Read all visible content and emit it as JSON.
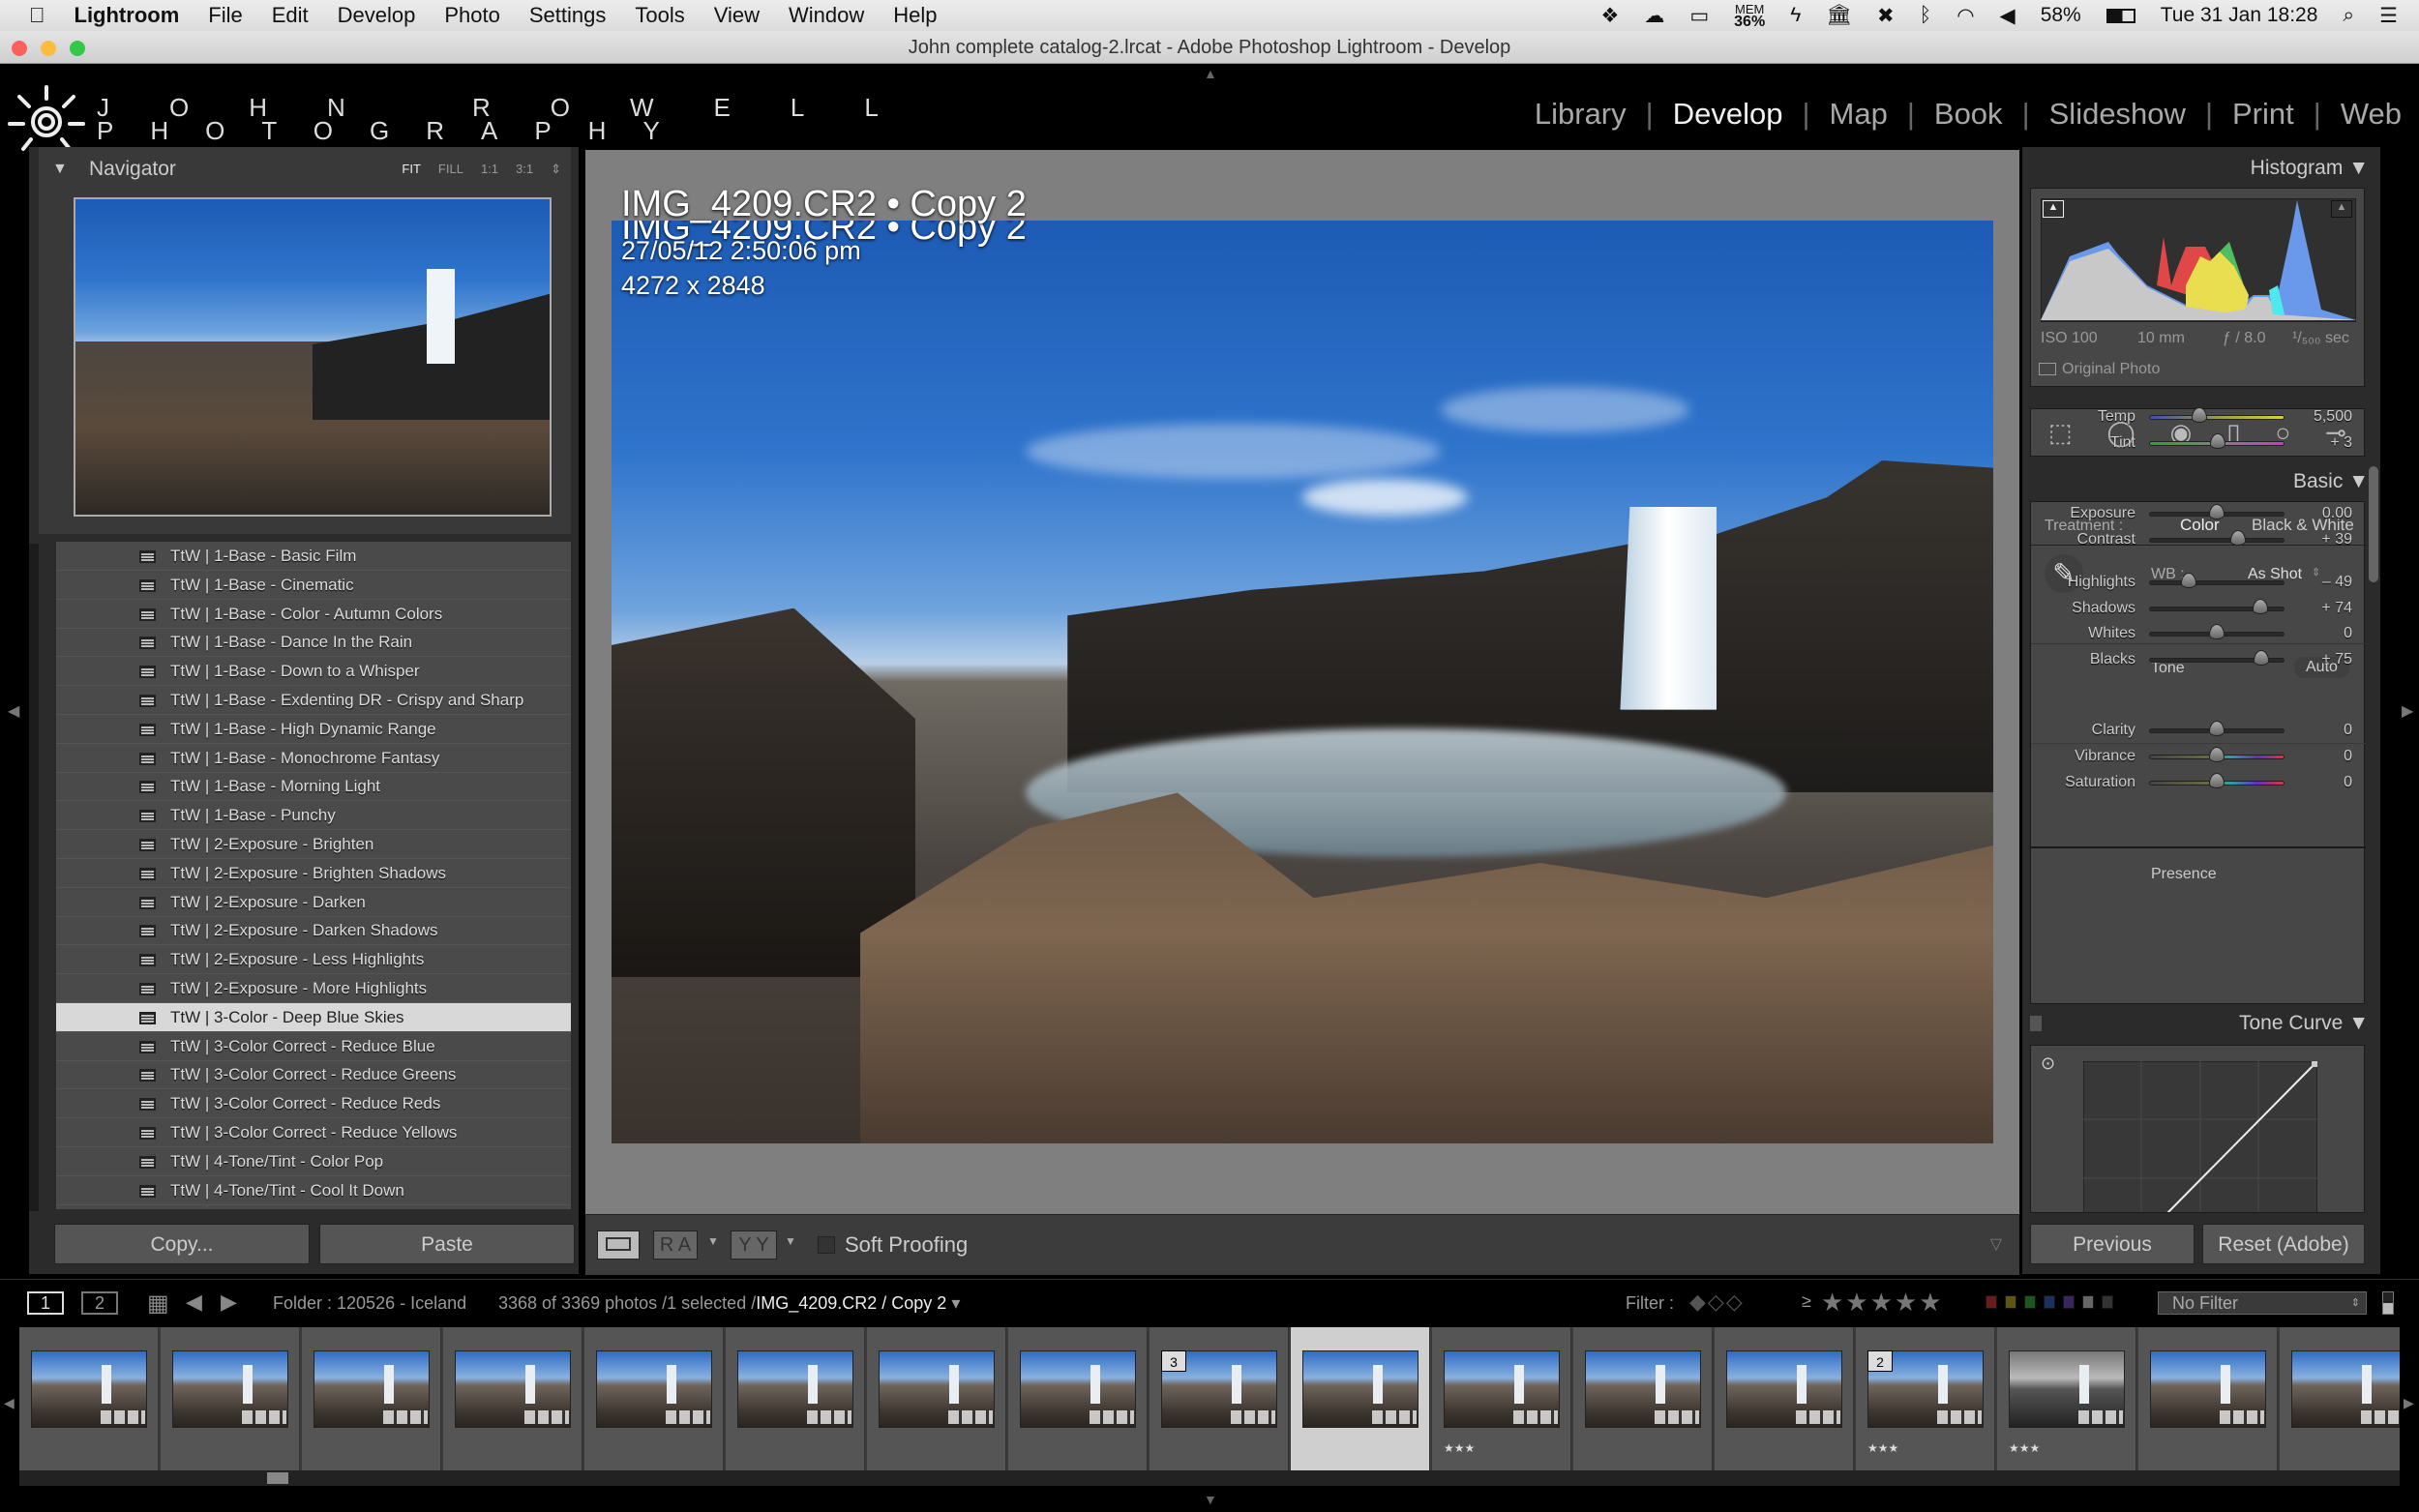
{
  "menubar": {
    "items": [
      "Lightroom",
      "File",
      "Edit",
      "Develop",
      "Photo",
      "Settings",
      "Tools",
      "View",
      "Window",
      "Help"
    ],
    "status": {
      "mem_label": "MEM",
      "mem_value": "36%",
      "battery": "58%",
      "datetime": "Tue 31 Jan  18:28"
    }
  },
  "window": {
    "title": "John complete catalog-2.lrcat - Adobe Photoshop Lightroom - Develop"
  },
  "identity": {
    "line1": "JOHN ROWELL",
    "line2": "PHOTOGRAPHY"
  },
  "modules": [
    {
      "label": "Library"
    },
    {
      "label": "Develop",
      "active": true
    },
    {
      "label": "Map"
    },
    {
      "label": "Book"
    },
    {
      "label": "Slideshow"
    },
    {
      "label": "Print"
    },
    {
      "label": "Web"
    }
  ],
  "navigator": {
    "title": "Navigator",
    "zoom": [
      "FIT",
      "FILL",
      "1:1",
      "3:1"
    ],
    "active_zoom": "FIT"
  },
  "presets": [
    "TtW | 1-Base - Basic Film",
    "TtW | 1-Base - Cinematic",
    "TtW | 1-Base - Color - Autumn Colors",
    "TtW | 1-Base - Dance In the Rain",
    "TtW | 1-Base - Down to a Whisper",
    "TtW | 1-Base - Exdenting DR - Crispy and Sharp",
    "TtW | 1-Base - High Dynamic Range",
    "TtW | 1-Base - Monochrome Fantasy",
    "TtW | 1-Base - Morning Light",
    "TtW | 1-Base - Punchy",
    "TtW | 2-Exposure - Brighten",
    "TtW | 2-Exposure - Brighten Shadows",
    "TtW | 2-Exposure - Darken",
    "TtW | 2-Exposure - Darken Shadows",
    "TtW | 2-Exposure - Less Highlights",
    "TtW | 2-Exposure - More Highlights",
    "TtW | 3-Color - Deep Blue Skies",
    "TtW | 3-Color Correct - Reduce Blue",
    "TtW | 3-Color Correct - Reduce Greens",
    "TtW | 3-Color Correct - Reduce Reds",
    "TtW | 3-Color Correct - Reduce Yellows",
    "TtW | 4-Tone/Tint - Color Pop",
    "TtW | 4-Tone/Tint - Cool It Down"
  ],
  "selected_preset": "TtW | 3-Color - Deep Blue Skies",
  "left_buttons": {
    "copy": "Copy...",
    "paste": "Paste"
  },
  "photo": {
    "name": "IMG_4209.CR2  •  Copy 2",
    "date": "27/05/12 2:50:06 pm",
    "dimensions": "4272 x 2848"
  },
  "toolbar": {
    "soft_proofing": "Soft Proofing",
    "ra": "R A",
    "yy": "Y Y"
  },
  "histogram": {
    "title": "Histogram",
    "iso": "ISO 100",
    "focal": "10 mm",
    "aperture": "ƒ / 8.0",
    "shutter": "¹/₅₀₀ sec",
    "original_photo": "Original Photo"
  },
  "basic": {
    "title": "Basic",
    "treatment_label": "Treatment :",
    "treatment_color": "Color",
    "treatment_bw": "Black & White",
    "wb_label": "WB :",
    "wb_value": "As Shot",
    "tone_label": "Tone",
    "auto_label": "Auto",
    "presence_label": "Presence",
    "sliders": [
      {
        "label": "Temp",
        "value": "5,500",
        "level": 0.37,
        "track": "temp"
      },
      {
        "label": "Tint",
        "value": "+ 3",
        "level": 0.51,
        "track": "tint"
      },
      {
        "label": "Exposure",
        "value": "0.00",
        "level": 0.5
      },
      {
        "label": "Contrast",
        "value": "+ 39",
        "level": 0.66
      },
      {
        "label": "Highlights",
        "value": "– 49",
        "level": 0.29
      },
      {
        "label": "Shadows",
        "value": "+ 74",
        "level": 0.82
      },
      {
        "label": "Whites",
        "value": "0",
        "level": 0.5
      },
      {
        "label": "Blacks",
        "value": "+ 75",
        "level": 0.83
      },
      {
        "label": "Clarity",
        "value": "0",
        "level": 0.5
      },
      {
        "label": "Vibrance",
        "value": "0",
        "level": 0.5,
        "track": "vib"
      },
      {
        "label": "Saturation",
        "value": "0",
        "level": 0.5,
        "track": "vib"
      }
    ]
  },
  "tone_curve": {
    "title": "Tone Curve"
  },
  "right_buttons": {
    "previous": "Previous",
    "reset": "Reset (Adobe)"
  },
  "filmstrip_bar": {
    "page1": "1",
    "page2": "2",
    "folder": "Folder : 120526 - Iceland",
    "count": "3368 of 3369 photos /1 selected /",
    "current": "IMG_4209.CR2 / Copy 2",
    "filter_label": "Filter :",
    "gte": "≥",
    "filter_value": "No Filter",
    "label_colors": [
      "#b03030",
      "#a09020",
      "#2f8f2f",
      "#3050a0",
      "#6040a0",
      "#aaaaaa",
      "#555555"
    ]
  },
  "filmstrip": [
    {},
    {},
    {},
    {},
    {},
    {},
    {},
    {},
    {
      "badge": "3"
    },
    {
      "selected": true
    },
    {
      "stars": "★★★"
    },
    {},
    {},
    {
      "badge": "2",
      "stars": "★★★"
    },
    {
      "bw": true,
      "stars": "★★★"
    },
    {},
    {}
  ]
}
